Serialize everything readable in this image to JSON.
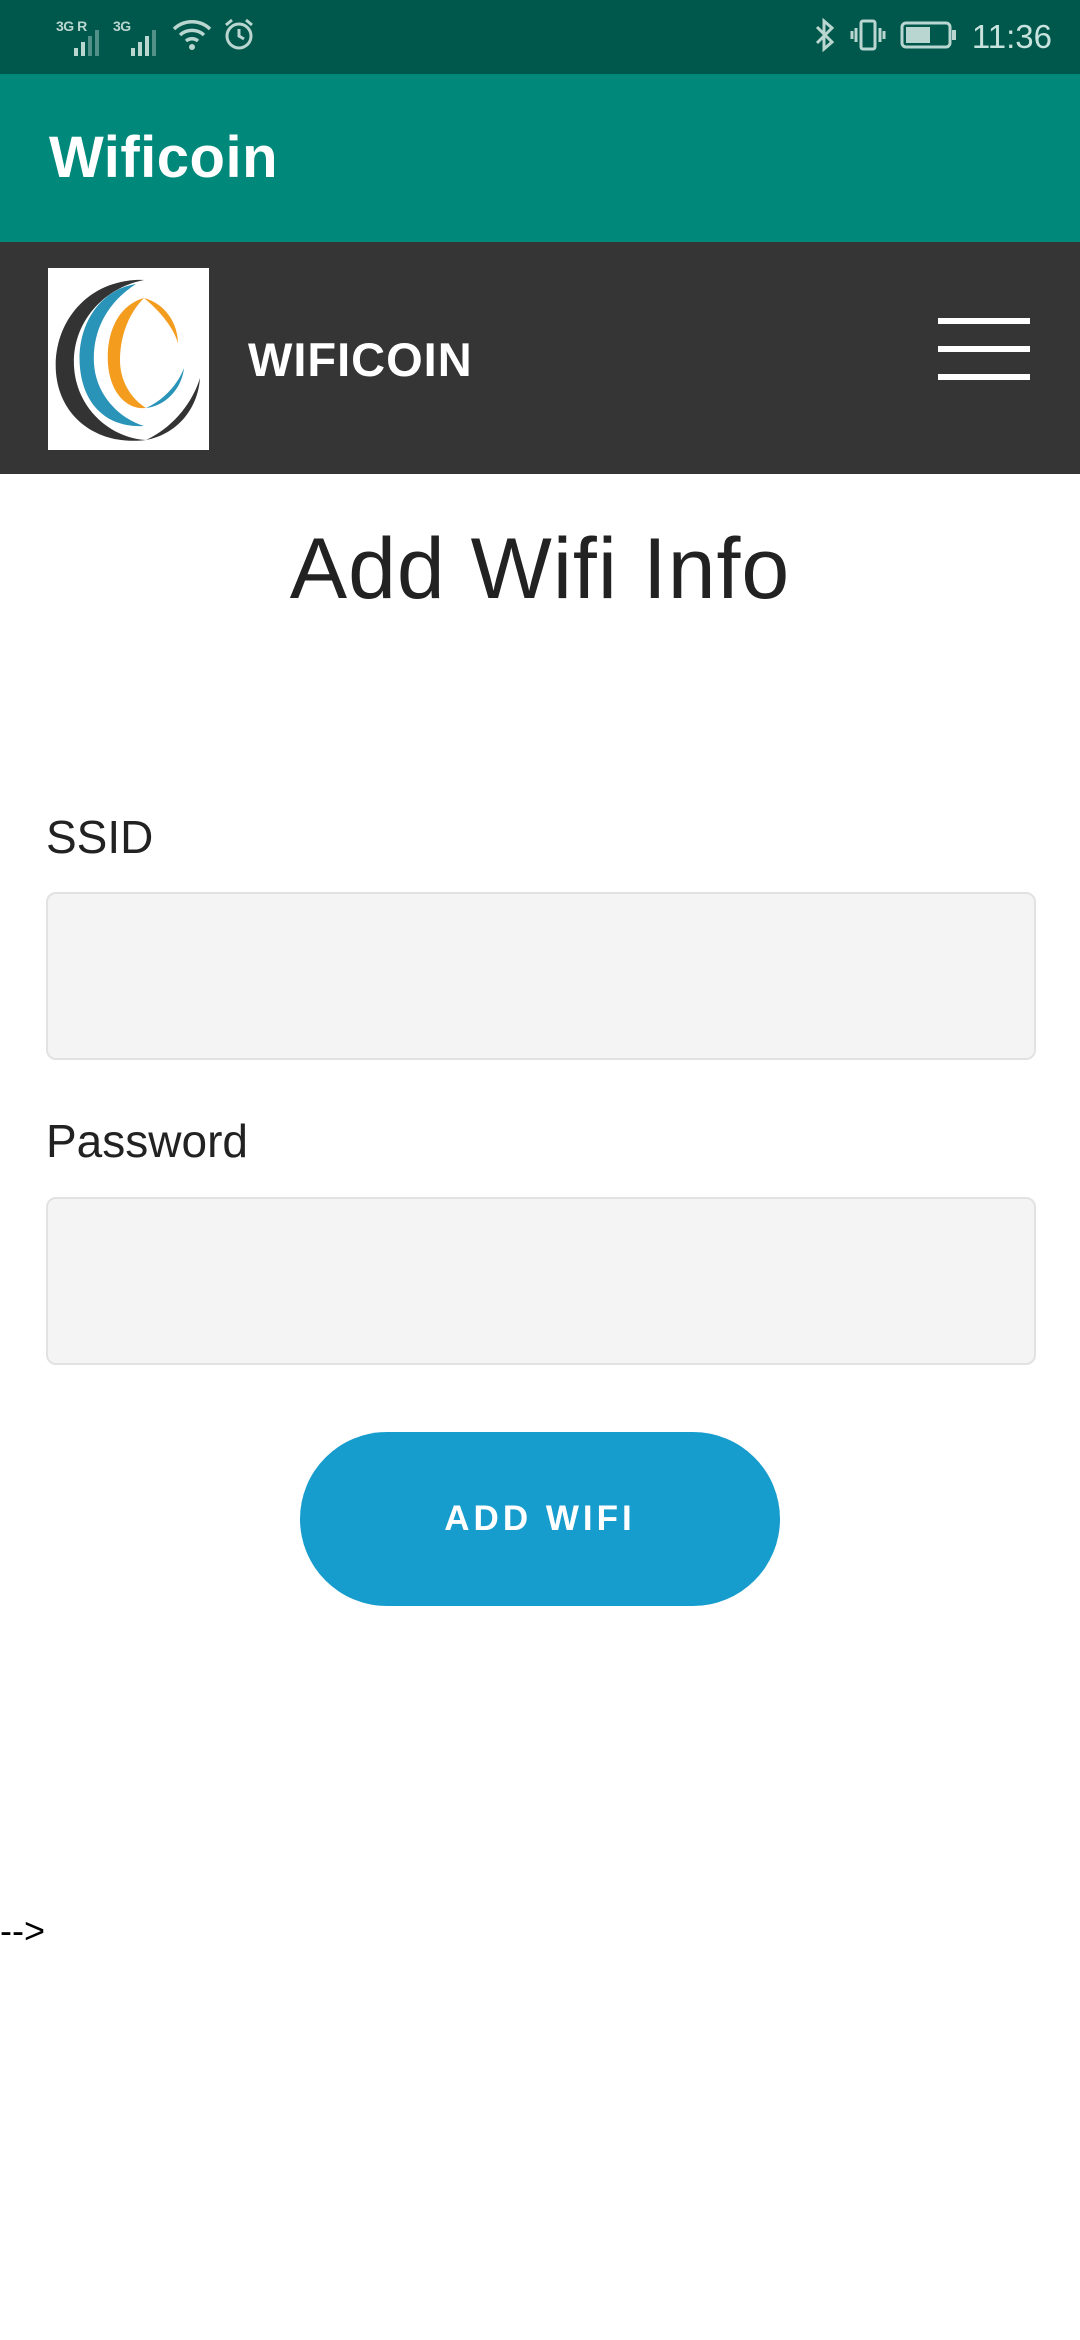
{
  "status_bar": {
    "network1_label": "3G R",
    "network2_label": "3G",
    "time": "11:36",
    "background": "#00574b"
  },
  "app_bar": {
    "title": "Wificoin",
    "background": "#00897b"
  },
  "site_header": {
    "brand": "WIFICOIN",
    "background": "#353535",
    "menu_icon": "hamburger-menu-icon"
  },
  "page": {
    "heading": "Add Wifi Info"
  },
  "form": {
    "ssid_label": "SSID",
    "ssid_value": "",
    "password_label": "Password",
    "password_value": "",
    "submit_label": "ADD WIFI",
    "submit_color": "#179dcd"
  },
  "stray_text": "-->"
}
